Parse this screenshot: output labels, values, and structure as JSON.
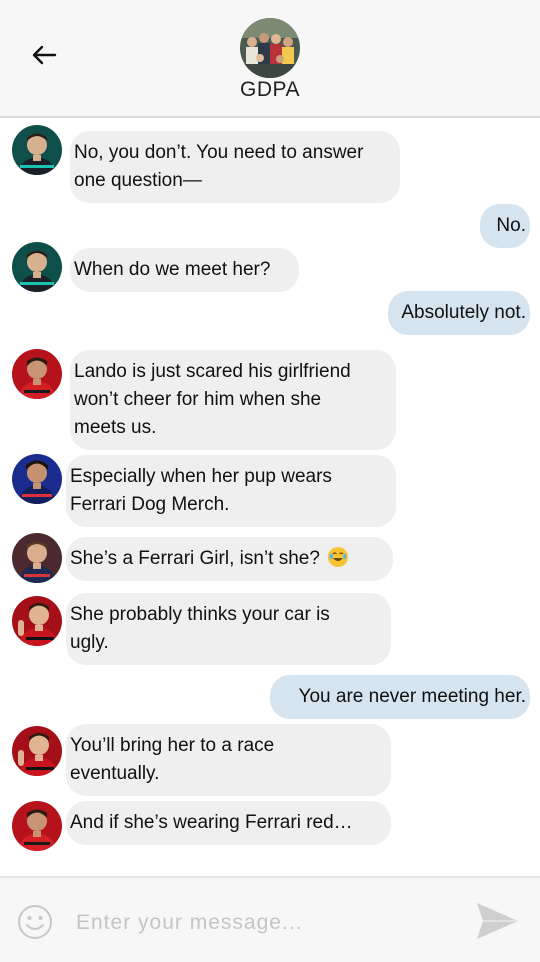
{
  "header": {
    "title": "GDPA",
    "back_icon": "back-arrow-icon"
  },
  "messages": [
    {
      "sender": "george",
      "lines": [
        "No, you don’t. You need to answer",
        "one question—"
      ]
    },
    {
      "sender": "me",
      "lines": [
        "No."
      ]
    },
    {
      "sender": "george",
      "lines": [
        "When do we meet her?"
      ]
    },
    {
      "sender": "me",
      "lines": [
        "Absolutely not."
      ]
    },
    {
      "sender": "carlos",
      "lines": [
        "Lando is just scared his girlfriend",
        "won’t cheer for him when she",
        "meets us."
      ]
    },
    {
      "sender": "daniel",
      "lines": [
        "Especially when her pup wears",
        "Ferrari Dog Merch."
      ]
    },
    {
      "sender": "max",
      "lines": [
        "She’s a Ferrari Girl, isn’t she?"
      ],
      "emoji": "laughing-tears-emoji"
    },
    {
      "sender": "charles",
      "lines": [
        "She probably thinks your car is",
        "ugly."
      ]
    },
    {
      "sender": "me",
      "lines": [
        "You are never meeting her."
      ]
    },
    {
      "sender": "charles",
      "lines": [
        "You’ll bring her to a race",
        "eventually."
      ]
    },
    {
      "sender": "carlos",
      "lines": [
        "And if she’s wearing Ferrari red…"
      ]
    }
  ],
  "composer": {
    "placeholder": "Enter your message...",
    "emoji_icon": "smiley-icon",
    "send_icon": "send-icon"
  },
  "colors": {
    "header_bg": "#f7f7f7",
    "incoming_bubble": "#efefef",
    "outgoing_bubble": "#d5e4ef",
    "send_icon": "#cfcfcf"
  }
}
